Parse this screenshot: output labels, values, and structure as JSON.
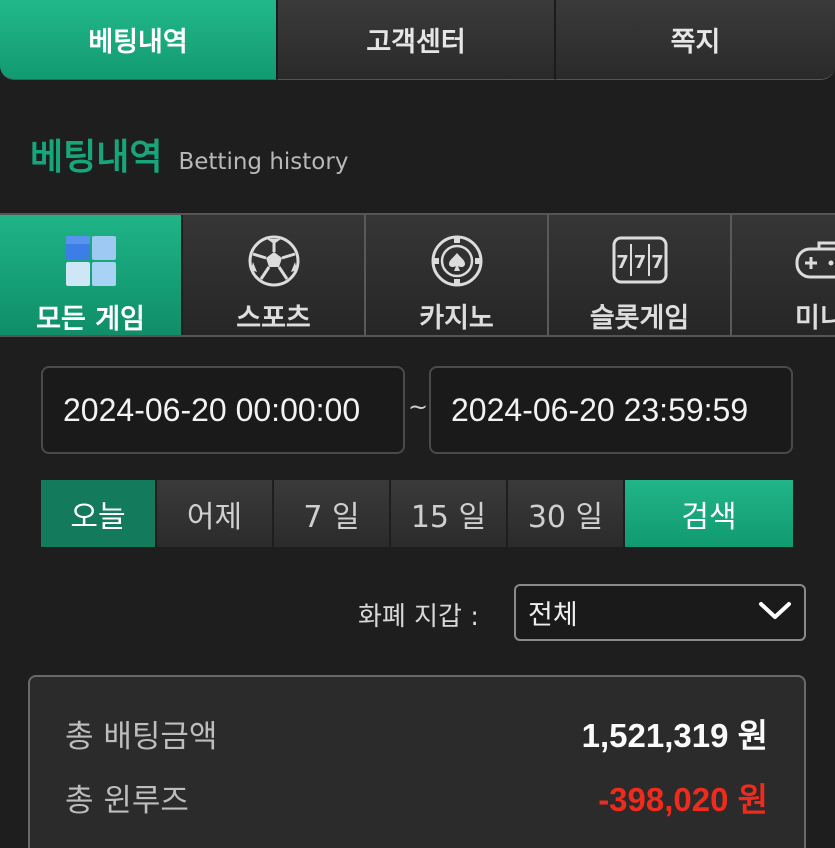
{
  "top_tabs": [
    "베팅내역",
    "고객센터",
    "쪽지"
  ],
  "heading": {
    "ko": "베팅내역",
    "en": "Betting history"
  },
  "categories": [
    {
      "label": "모든 게임",
      "icon": "all-games-icon"
    },
    {
      "label": "스포츠",
      "icon": "soccer-ball-icon"
    },
    {
      "label": "카지노",
      "icon": "casino-chip-icon"
    },
    {
      "label": "슬롯게임",
      "icon": "slot-machine-icon"
    },
    {
      "label": "미니",
      "icon": "gamepad-icon"
    }
  ],
  "date_range": {
    "start": "2024-06-20 00:00:00",
    "separator": "~",
    "end": "2024-06-20 23:59:59"
  },
  "quick_ranges": [
    "오늘",
    "어제",
    "7 일",
    "15 일",
    "30 일"
  ],
  "search_label": "검색",
  "currency": {
    "label": "화폐 지갑 :",
    "selected": "전체"
  },
  "summary": {
    "total_bet_label": "총 배팅금액",
    "total_bet_value": "1,521,319 원",
    "total_winloss_label": "총 윈루즈",
    "total_winloss_value": "-398,020 원"
  },
  "colors": {
    "accent": "#17a57a",
    "negative": "#ee2b1c",
    "background": "#1e1e1e"
  }
}
